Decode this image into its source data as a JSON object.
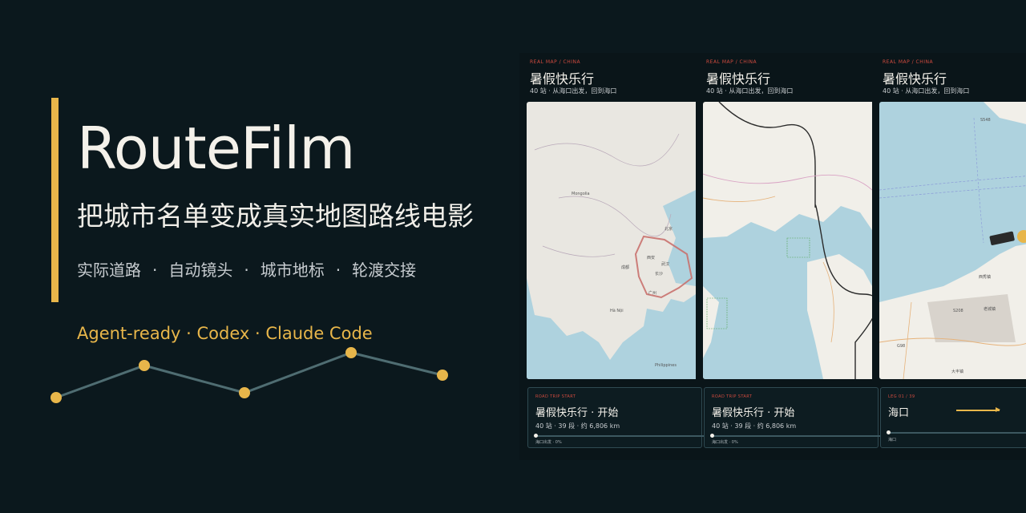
{
  "hero": {
    "title": "RouteFilm",
    "subtitle": "把城市名单变成真实地图路线电影",
    "features": [
      "实际道路",
      "自动镜头",
      "城市地标",
      "轮渡交接"
    ],
    "separator": "·",
    "agents": "Agent-ready · Codex · Claude Code"
  },
  "colors": {
    "background": "#0b181d",
    "accent": "#e8b64a",
    "route_line": "#4f6d72",
    "red_kicker": "#d04b3f"
  },
  "cards": [
    {
      "kicker": "REAL MAP / CHINA",
      "title": "暑假快乐行",
      "meta": "40 站 ·  从海口出发，回到海口",
      "map_labels": [
        "北京",
        "西安",
        "武汉",
        "长沙",
        "广州",
        "成都",
        "Hà Nội",
        "Philippines",
        "Mongolia"
      ],
      "panel": {
        "kicker": "ROAD TRIP START",
        "title": "暑假快乐行 ·   开始",
        "meta": "40 站 ·   39 段 ·   约 6,806 km",
        "progress_label": "海口出发 ·  0%",
        "progress": 0
      }
    },
    {
      "kicker": "REAL MAP / CHINA",
      "title": "暑假快乐行",
      "meta": "40 站 ·  从海口出发，回到海口",
      "map_labels": [],
      "panel": {
        "kicker": "ROAD TRIP START",
        "title": "暑假快乐行 ·   开始",
        "meta": "40 站 ·   39 段 ·   约 6,806 km",
        "progress_label": "海口出发 ·  0%",
        "progress": 0
      }
    },
    {
      "kicker": "REAL MAP / CHINA",
      "title": "暑假快乐行",
      "meta": "40 站 ·  从海口出发，回到海口",
      "map_labels": [
        "S548",
        "S208",
        "G98",
        "西秀镇",
        "老城镇",
        "大丰镇"
      ],
      "panel": {
        "kicker": "LEG 01 / 39",
        "title": "海口",
        "progress_label": "海口",
        "progress": 0
      }
    }
  ]
}
